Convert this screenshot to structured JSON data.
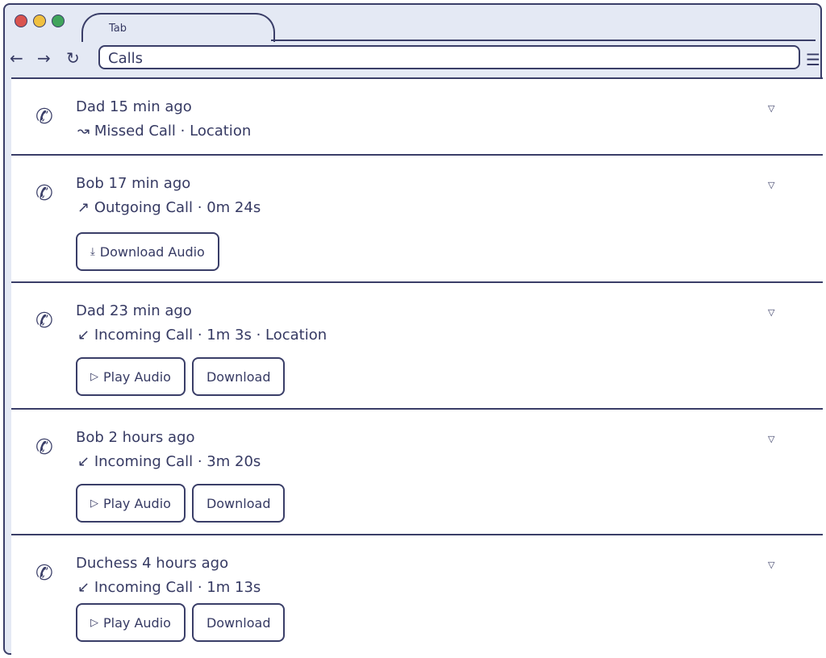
{
  "browser": {
    "tab_label": "Tab",
    "address": "Calls",
    "back_icon": "←",
    "forward_icon": "→",
    "reload_icon": "↻",
    "menu_icon": "☰",
    "traffic_lights": [
      "#d9534f",
      "#f0c040",
      "#3fa45b"
    ]
  },
  "calls": [
    {
      "title": "Dad 15 min ago",
      "direction_icon": "↝",
      "subtitle": "Missed Call · Location",
      "buttons": []
    },
    {
      "title": "Bob 17 min ago",
      "direction_icon": "↗",
      "subtitle": "Outgoing Call · 0m 24s",
      "buttons": [
        {
          "icon": "⤓",
          "label": "Download Audio"
        }
      ]
    },
    {
      "title": "Dad 23 min ago",
      "direction_icon": "↙",
      "subtitle": "Incoming Call · 1m 3s · Location",
      "buttons": [
        {
          "icon": "▷",
          "label": "Play Audio"
        },
        {
          "icon": "",
          "label": "Download"
        }
      ]
    },
    {
      "title": "Bob 2 hours ago",
      "direction_icon": "↙",
      "subtitle": "Incoming Call · 3m 20s",
      "buttons": [
        {
          "icon": "▷",
          "label": "Play Audio"
        },
        {
          "icon": "",
          "label": "Download"
        }
      ]
    },
    {
      "title": "Duchess 4 hours ago",
      "direction_icon": "↙",
      "subtitle": "Incoming Call · 1m 13s",
      "buttons": [
        {
          "icon": "▷",
          "label": "Play Audio"
        },
        {
          "icon": "",
          "label": "Download"
        }
      ]
    }
  ]
}
